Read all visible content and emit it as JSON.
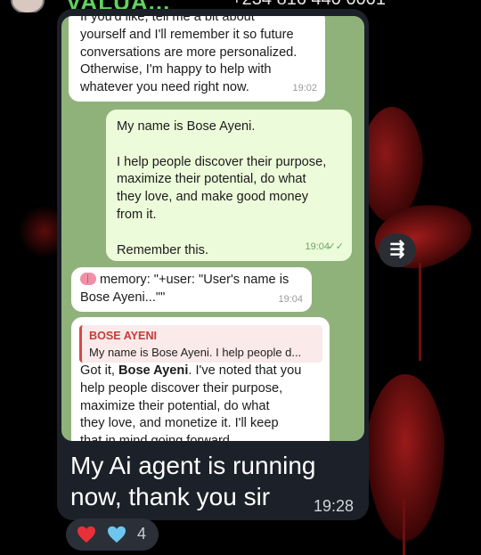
{
  "header": {
    "contact_name": "VALUA...",
    "phone": "+234 816 440 0001"
  },
  "embedded_chat": {
    "messages": [
      {
        "lines": [
          "If you'd like, tell me a bit about",
          "yourself and I'll remember it so future",
          "conversations are more personalized.",
          "Otherwise, I'm happy to help with",
          "whatever you need right now."
        ],
        "time": "19:02"
      },
      {
        "lines": [
          "My name is Bose Ayeni.",
          "",
          "I help people discover their purpose,",
          "maximize their potential, do what",
          "they love, and make good money",
          "from it.",
          "",
          "Remember this."
        ],
        "time": "19:04",
        "status": "✓✓"
      },
      {
        "line1": "memory: \"+user: \"User's name is",
        "line2": "Bose Ayeni...\"\"",
        "time": "19:04"
      },
      {
        "reply_name": "BOSE AYENI",
        "reply_text": "My name is Bose Ayeni.  I help people d...",
        "intro": "Got it, ",
        "name_bold": "Bose Ayeni",
        "rest_first": ". I've noted that you",
        "lines": [
          "help people discover their purpose,",
          "maximize their potential, do what",
          "they love, and monetize it. I'll keep",
          "that in mind going forward."
        ]
      }
    ]
  },
  "forward_button": {
    "icon": "forward-icon",
    "glyph": "⇶"
  },
  "caption": {
    "text": "My Ai agent is running now, thank you sir",
    "time": "19:28"
  },
  "reactions": {
    "count": "4",
    "items": [
      "red-heart-icon",
      "blue-heart-icon"
    ],
    "colors": {
      "red": "#e8303a",
      "blue": "#6ec6f0"
    }
  }
}
